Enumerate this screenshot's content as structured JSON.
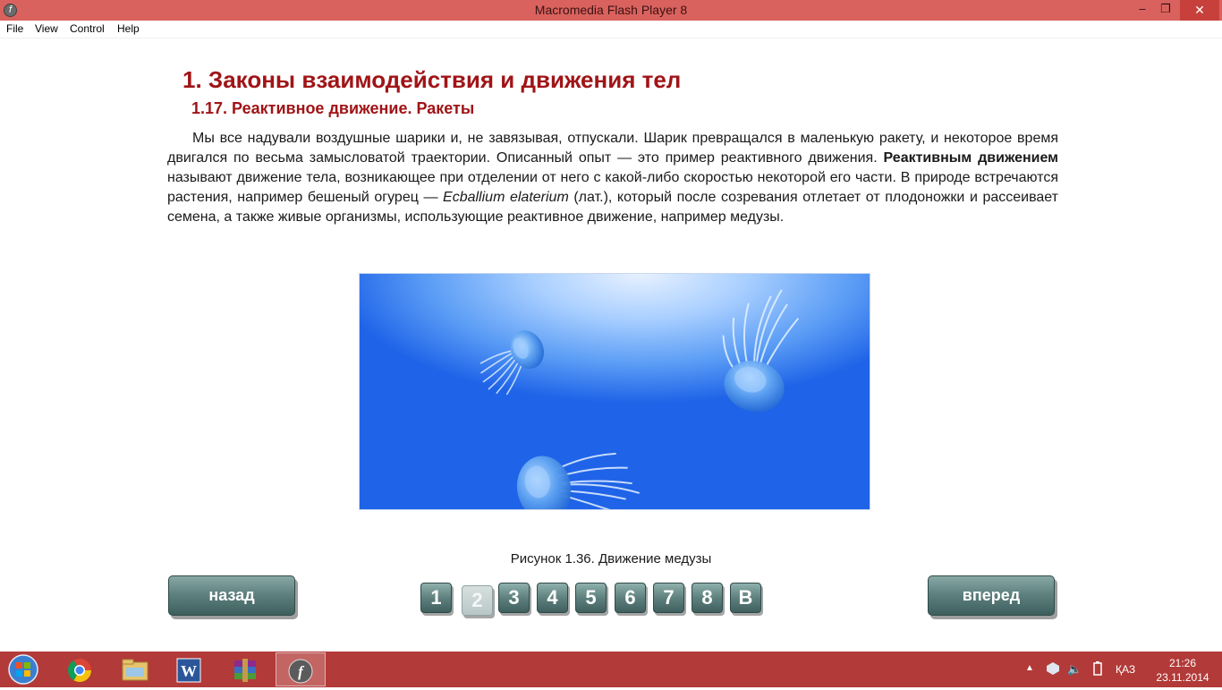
{
  "window": {
    "title": "Macromedia Flash Player 8",
    "controls": {
      "minimize": "‒",
      "maximize": "❐",
      "close": "✕"
    }
  },
  "menu": [
    "File",
    "View",
    "Control",
    "Help"
  ],
  "content": {
    "heading": "1. Законы взаимодействия и движения тел",
    "subheading": "1.17. Реактивное движение. Ракеты",
    "paragraph": {
      "p1": "Мы все надували воздушные шарики и, не завязывая, отпускали. Шарик превращался в маленькую ракету, и некоторое время двигался по весьма замысловатой траектории. Описанный опыт — это пример реактивного движения. ",
      "bold": "Реактивным движением",
      "p2": " называют движение тела, возникающее при отделении от него с какой-либо скоростью некоторой его части. В природе встречаются растения, например бешеный огурец — ",
      "italic": "Ecballium elaterium",
      "p3": " (лат.), который после созревания отлетает от плодоножки и рассеивает семена, а также живые организмы, использующие реактивное движение, например медузы."
    },
    "figure_caption": "Рисунок 1.36. Движение медузы"
  },
  "navigation": {
    "back_label": "назад",
    "forward_label": "вперед",
    "pages": [
      "1",
      "2",
      "3",
      "4",
      "5",
      "6",
      "7",
      "8",
      "В"
    ],
    "current_page": "2"
  },
  "taskbar": {
    "apps": [
      "start-button",
      "chrome-icon",
      "file-explorer-icon",
      "word-icon",
      "winrar-icon",
      "flash-player-icon"
    ],
    "active_app": "flash-player-icon",
    "tray": {
      "language": "ҚАЗ"
    },
    "clock": {
      "time": "21:26",
      "date": "23.11.2014"
    }
  },
  "colors": {
    "titlebar": "#d9625e",
    "taskbar": "#b23a38",
    "heading": "#a01417",
    "button": "#5f817f"
  }
}
